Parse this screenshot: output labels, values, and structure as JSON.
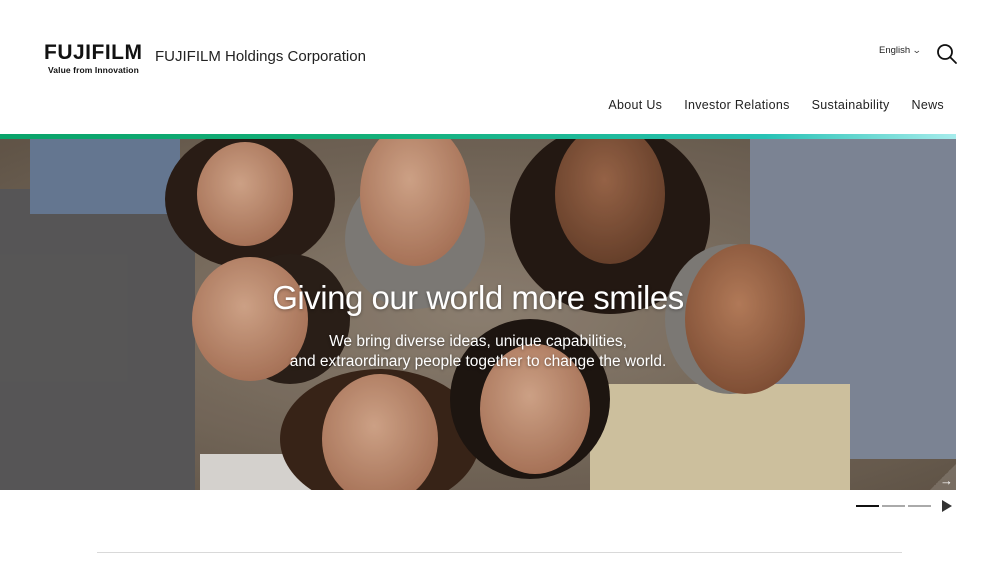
{
  "header": {
    "logo": {
      "wordmark": "FUJIFILM",
      "tagline": "Value from Innovation"
    },
    "corporation_name": "FUJIFILM Holdings Corporation",
    "language": "English"
  },
  "nav": {
    "items": [
      {
        "label": "About Us"
      },
      {
        "label": "Investor Relations"
      },
      {
        "label": "Sustainability"
      },
      {
        "label": "News"
      }
    ]
  },
  "hero": {
    "title": "Giving our world more smiles",
    "subtitle_line1": "We bring diverse ideas, unique capabilities,",
    "subtitle_line2": "and extraordinary people together to change the world.",
    "next_glyph": "→"
  },
  "carousel": {
    "slide_count": 3,
    "active_index": 0,
    "accent_colors": [
      "#0aa36a",
      "#27c2b5"
    ]
  },
  "icons": [
    "search-icon",
    "chevron-down-icon",
    "arrow-right-icon",
    "play-icon"
  ]
}
